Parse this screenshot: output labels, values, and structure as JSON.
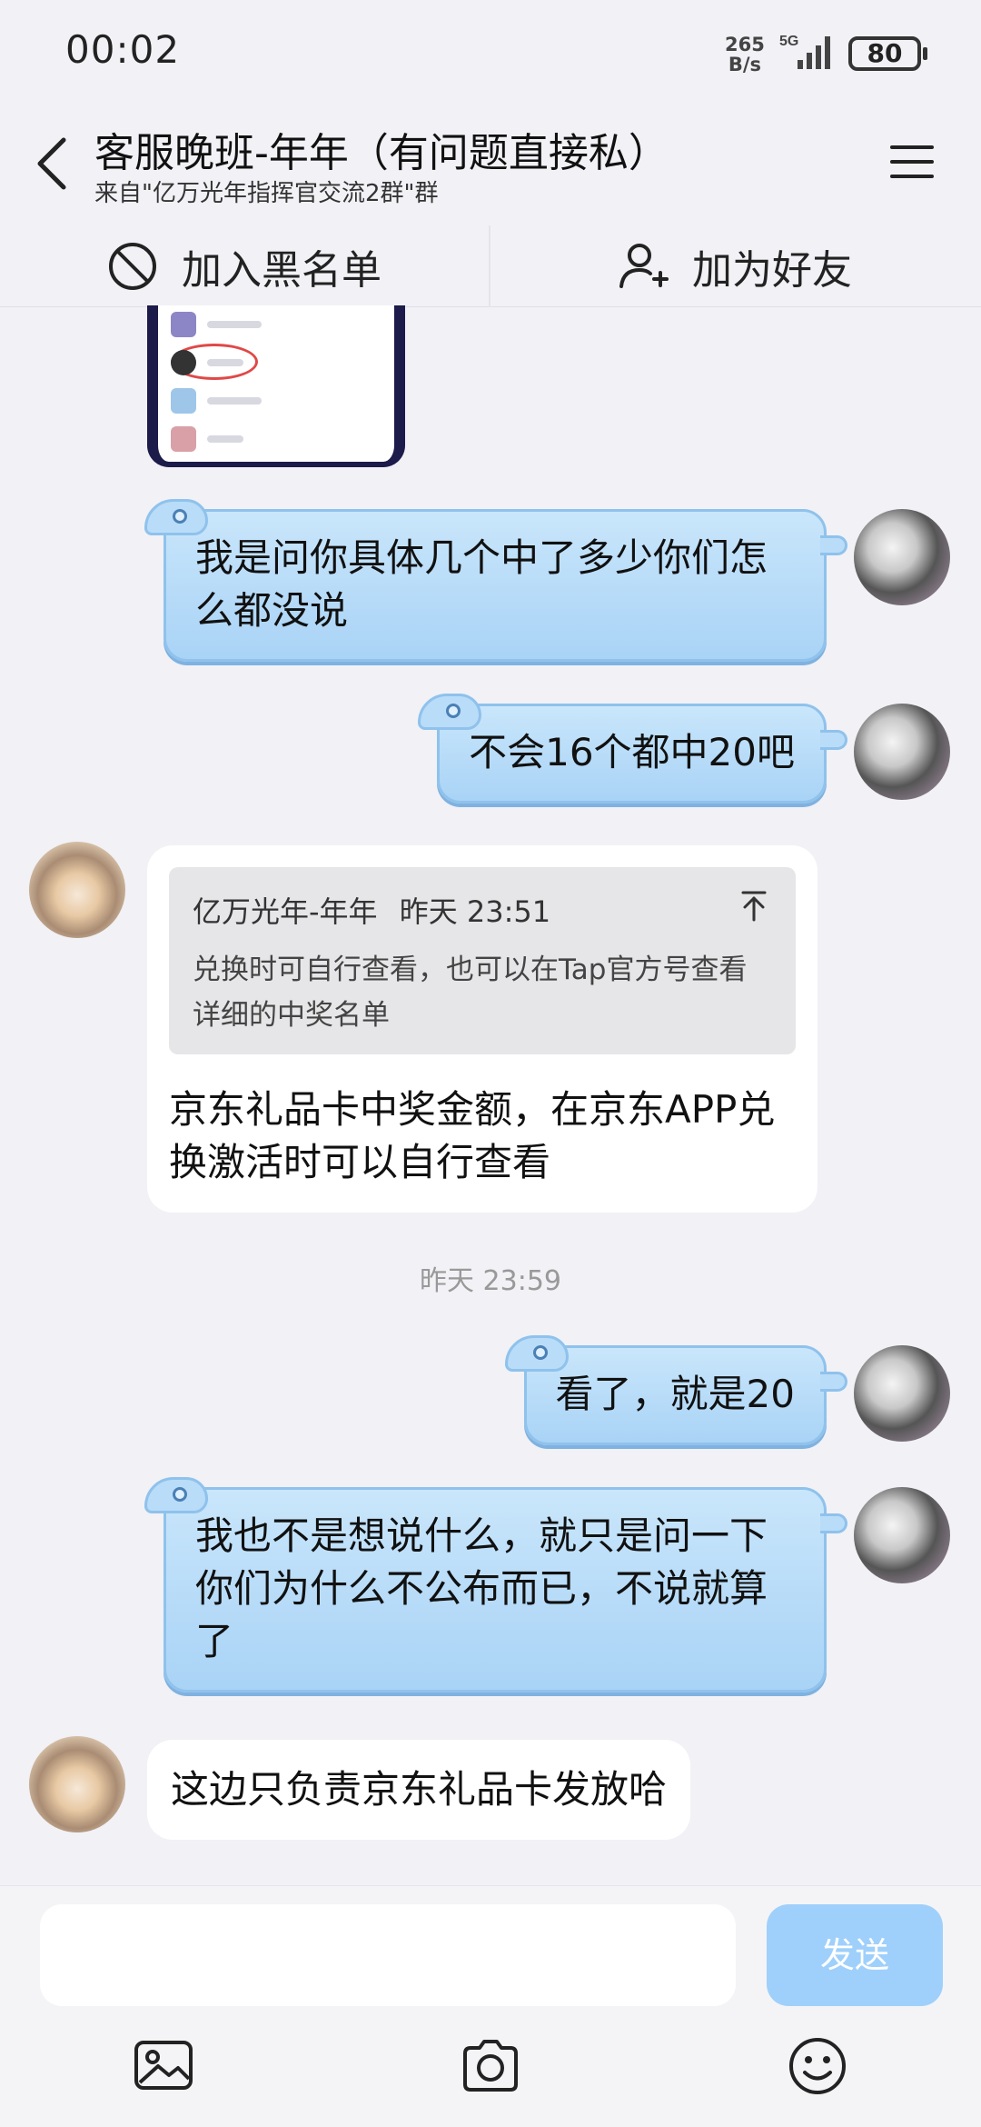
{
  "status_bar": {
    "time": "00:02",
    "net_speed_value": "265",
    "net_speed_unit": "B/s",
    "network": "5G",
    "battery": "80"
  },
  "header": {
    "title": "客服晚班-年年（有问题直接私）",
    "subtitle": "来自\"亿万光年指挥官交流2群\"群",
    "back_icon": "chevron-left-icon",
    "menu_icon": "hamburger-menu-icon"
  },
  "actions": {
    "blacklist_label": "加入黑名单",
    "add_friend_label": "加为好友"
  },
  "messages": {
    "out_1": "我是问你具体几个中了多少你们怎么都没说",
    "out_2": "不会16个都中20吧",
    "in_1": {
      "quote_author": "亿万光年-年年",
      "quote_time": "昨天 23:51",
      "quote_text": "兑换时可自行查看，也可以在Tap官方号查看详细的中奖名单",
      "text": "京东礼品卡中奖金额，在京东APP兑换激活时可以自行查看"
    },
    "timestamp": "昨天 23:59",
    "out_3": "看了，就是20",
    "out_4": "我也不是想说什么，就只是问一下你们为什么不公布而已，不说就算了",
    "in_2": "这边只负责京东礼品卡发放哈"
  },
  "input_bar": {
    "input_value": "",
    "send_label": "发送"
  },
  "colors": {
    "bubble_out": "#b9dcf8",
    "send_button": "#9fd0fb",
    "background": "#f1f1f6"
  }
}
